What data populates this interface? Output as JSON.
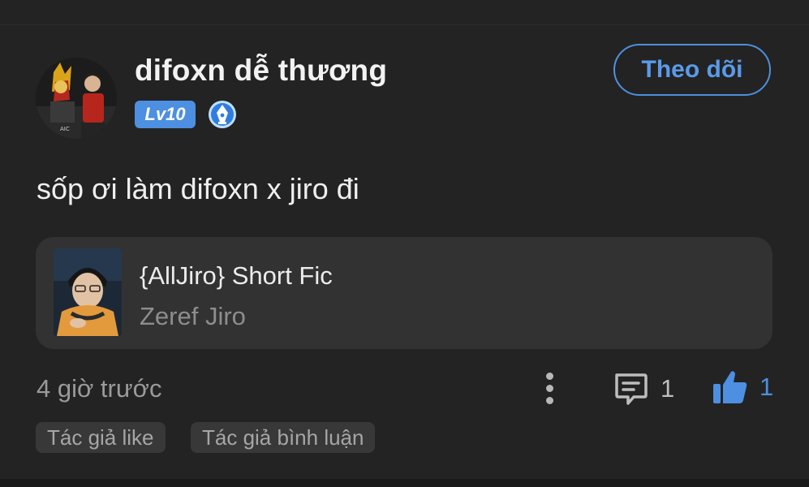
{
  "user": {
    "name": "difoxn dễ thương",
    "level": "Lv10",
    "follow_label": "Theo dõi"
  },
  "comment": {
    "text": "sốp ơi làm difoxn x jiro đi",
    "time": "4 giờ trước",
    "comment_count": "1",
    "like_count": "1"
  },
  "story": {
    "title": "{AllJiro} Short Fic",
    "author": "Zeref Jiro"
  },
  "tags": {
    "author_like": "Tác giả like",
    "author_comment": "Tác giả bình luận"
  },
  "colors": {
    "background": "#232323",
    "card": "#323232",
    "accent": "#4d8fe0",
    "text": "#ececec",
    "muted": "#9a9a9a"
  },
  "icons": {
    "badge": "pen-nib-badge-icon",
    "more": "more-vertical-icon",
    "comment": "comment-bubble-icon",
    "like": "thumbs-up-icon"
  }
}
